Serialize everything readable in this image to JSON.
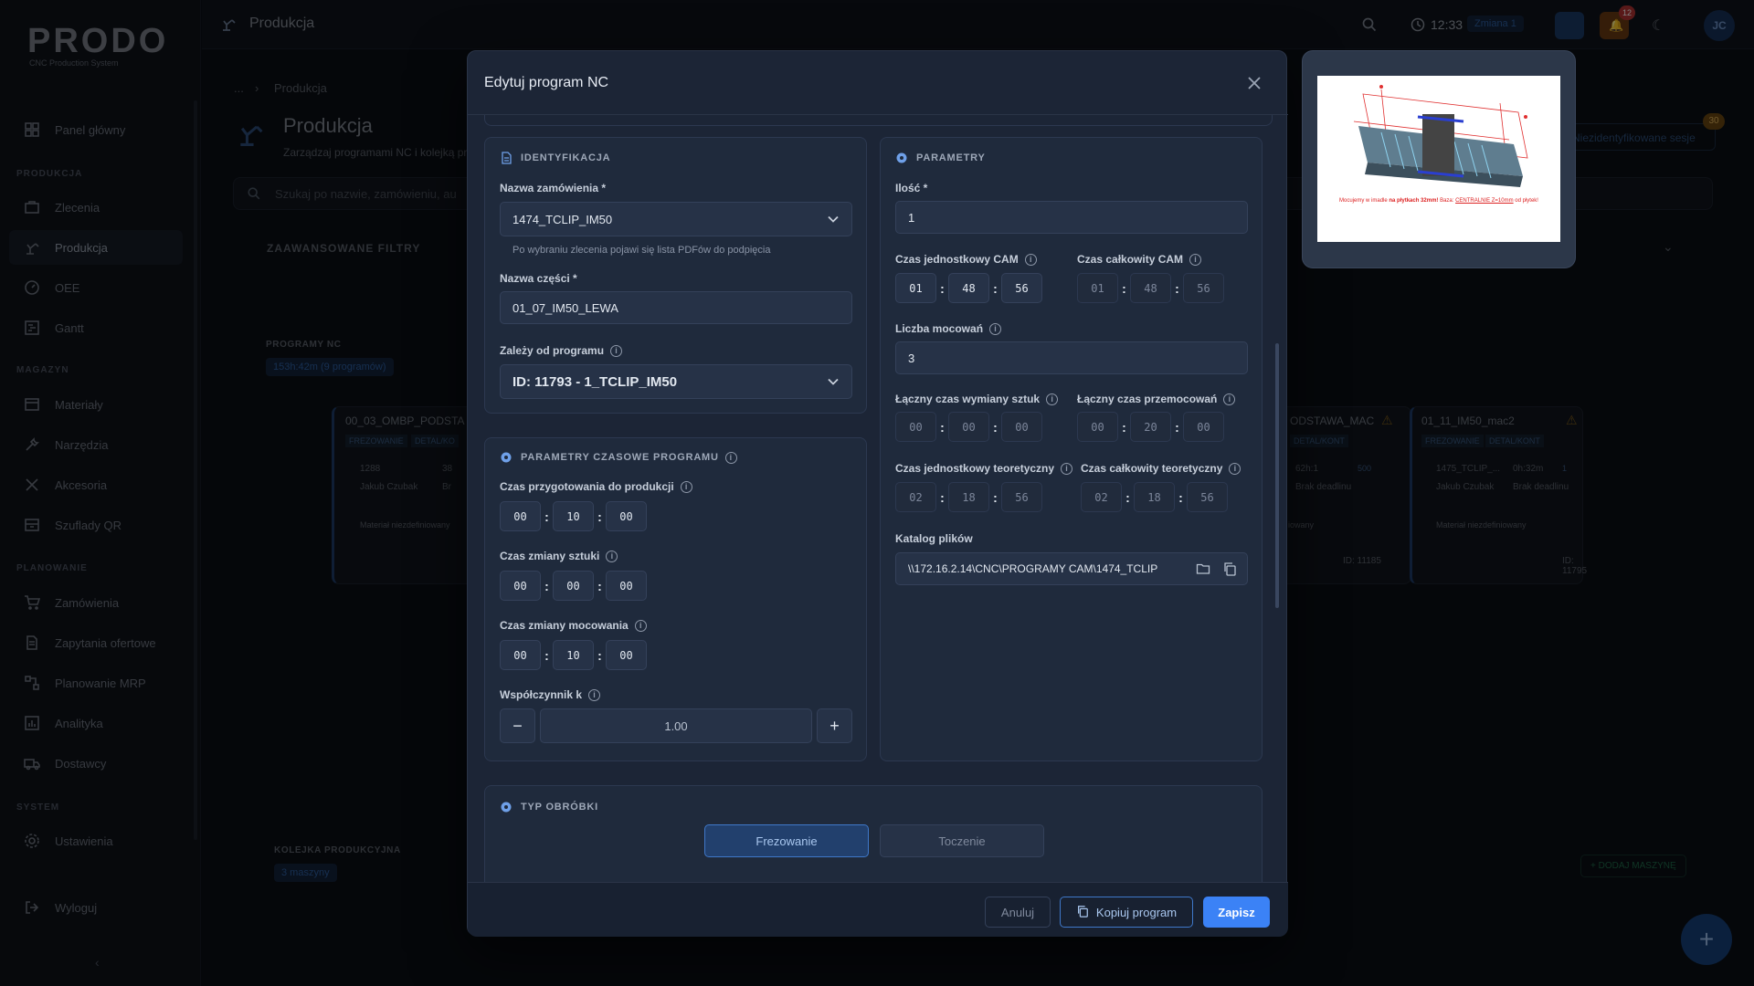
{
  "app": {
    "logo": "PRODO",
    "logo_sub": "CNC Production System",
    "page": "Produkcja"
  },
  "sidebar": {
    "dashboard": "Panel główny",
    "sec_production": "PRODUKCJA",
    "orders": "Zlecenia",
    "production": "Produkcja",
    "oee": "OEE",
    "gantt": "Gantt",
    "sec_warehouse": "MAGAZYN",
    "materials": "Materiały",
    "tools": "Narzędzia",
    "accessories": "Akcesoria",
    "qr_drawers": "Szuflady QR",
    "sec_planning": "PLANOWANIE",
    "purchase_orders": "Zamówienia",
    "inquiries": "Zapytania ofertowe",
    "mrp": "Planowanie MRP",
    "analytics": "Analityka",
    "suppliers": "Dostawcy",
    "sec_system": "SYSTEM",
    "settings": "Ustawienia",
    "logout": "Wyloguj"
  },
  "topbar": {
    "time": "12:33",
    "shift": "Zmiana 1",
    "notifications": "12",
    "avatar": "JC"
  },
  "background": {
    "breadcrumb_sep": "...",
    "breadcrumb_current": "Produkcja",
    "heading": "Produkcja",
    "subtitle": "Zarządzaj programami NC i kolejką pr",
    "search_placeholder": "Szukaj po nazwie, zamówieniu, au",
    "filters": "ZAAWANSOWANE FILTRY",
    "unidentified": "Niezidentyfikowane sesje",
    "unidentified_count": "30",
    "programs_label": "PROGRAMY NC",
    "programs_time": "153h:42m",
    "programs_count": "(9 programów)",
    "card1_title": "00_03_OMBP_PODSTA",
    "card1_tag1": "FREZOWANIE",
    "card1_tag2": "DETAL/KO",
    "card1_qty": "1288",
    "card1_n": "38",
    "card1_user": "Jakub Czubak",
    "card1_deadline": "Br",
    "card1_material": "Materiał niezdefiniowany",
    "card2_title": "ODSTAWA_MAC",
    "card2_tag": "DETAL/KONT",
    "card2_time": "62h:1",
    "card2_n": "500",
    "card2_deadline": "Brak deadlinu",
    "card2_material": "iowany",
    "card2_id": "ID: 11185",
    "card3_title": "01_11_IM50_mac2",
    "card3_tag1": "FREZOWANIE",
    "card3_tag2": "DETAL/KONT",
    "card3_qty": "1475_TCLIP_...",
    "card3_time": "0h:32m",
    "card3_n": "1",
    "card3_user": "Jakub Czubak",
    "card3_deadline": "Brak deadlinu",
    "card3_material": "Materiał niezdefiniowany",
    "card3_id": "ID: 11795",
    "queue_label": "KOLEJKA PRODUKCYJNA",
    "queue_count": "3 maszyny",
    "add_machine": "+ DODAJ MASZYNĘ"
  },
  "modal": {
    "title": "Edytuj program NC",
    "ident": {
      "header": "IDENTYFIKACJA",
      "order_label": "Nazwa zamówienia *",
      "order_value": "1474_TCLIP_IM50",
      "order_hint": "Po wybraniu zlecenia pojawi się lista PDFów do podpięcia",
      "part_label": "Nazwa części *",
      "part_value": "01_07_IM50_LEWA",
      "depends_label": "Zależy od programu",
      "depends_value": "ID: 11793 - 1_TCLIP_IM50"
    },
    "time": {
      "header": "PARAMETRY CZASOWE PROGRAMU",
      "prep_label": "Czas przygotowania do produkcji",
      "prep": [
        "00",
        "10",
        "00"
      ],
      "piece_change_label": "Czas zmiany sztuki",
      "piece_change": [
        "00",
        "00",
        "00"
      ],
      "fixture_change_label": "Czas zmiany mocowania",
      "fixture_change": [
        "00",
        "10",
        "00"
      ],
      "k_label": "Współczynnik k",
      "k_value": "1.00",
      "minus": "−",
      "plus": "+"
    },
    "params": {
      "header": "PARAMETRY",
      "qty_label": "Ilość *",
      "qty_value": "1",
      "cam_unit_label": "Czas jednostkowy CAM",
      "cam_unit": [
        "01",
        "48",
        "56"
      ],
      "cam_total_label": "Czas całkowity CAM",
      "cam_total": [
        "01",
        "48",
        "56"
      ],
      "fixtures_label": "Liczba mocowań",
      "fixtures_value": "3",
      "total_piece_change_label": "Łączny czas wymiany sztuk",
      "total_piece_change": [
        "00",
        "00",
        "00"
      ],
      "total_refixture_label": "Łączny czas przemocowań",
      "total_refixture": [
        "00",
        "20",
        "00"
      ],
      "theo_unit_label": "Czas jednostkowy teoretyczny",
      "theo_unit": [
        "02",
        "18",
        "56"
      ],
      "theo_total_label": "Czas całkowity teoretyczny",
      "theo_total": [
        "02",
        "18",
        "56"
      ],
      "dir_label": "Katalog plików",
      "dir_value": "\\\\172.16.2.14\\CNC\\PROGRAMY CAM\\1474_TCLIP"
    },
    "machining": {
      "header": "TYP OBRÓBKI",
      "milling": "Frezowanie",
      "turning": "Toczenie",
      "selected": "Frezowanie"
    },
    "footer": {
      "cancel": "Anuluj",
      "copy": "Kopiuj program",
      "save": "Zapisz"
    }
  },
  "preview": {
    "caption_pre": "Mocujemy w imadle ",
    "caption_bold": "na płytkach 32mm!",
    "caption_mid": " Baza: ",
    "caption_red": "CENTRALNIE Z=10mm",
    "caption_post": " od płytek!"
  },
  "colors": {
    "primary": "#3b82f6",
    "warning": "#f59e0b",
    "danger": "#ef4444",
    "modal_bg": "#1c2536"
  }
}
